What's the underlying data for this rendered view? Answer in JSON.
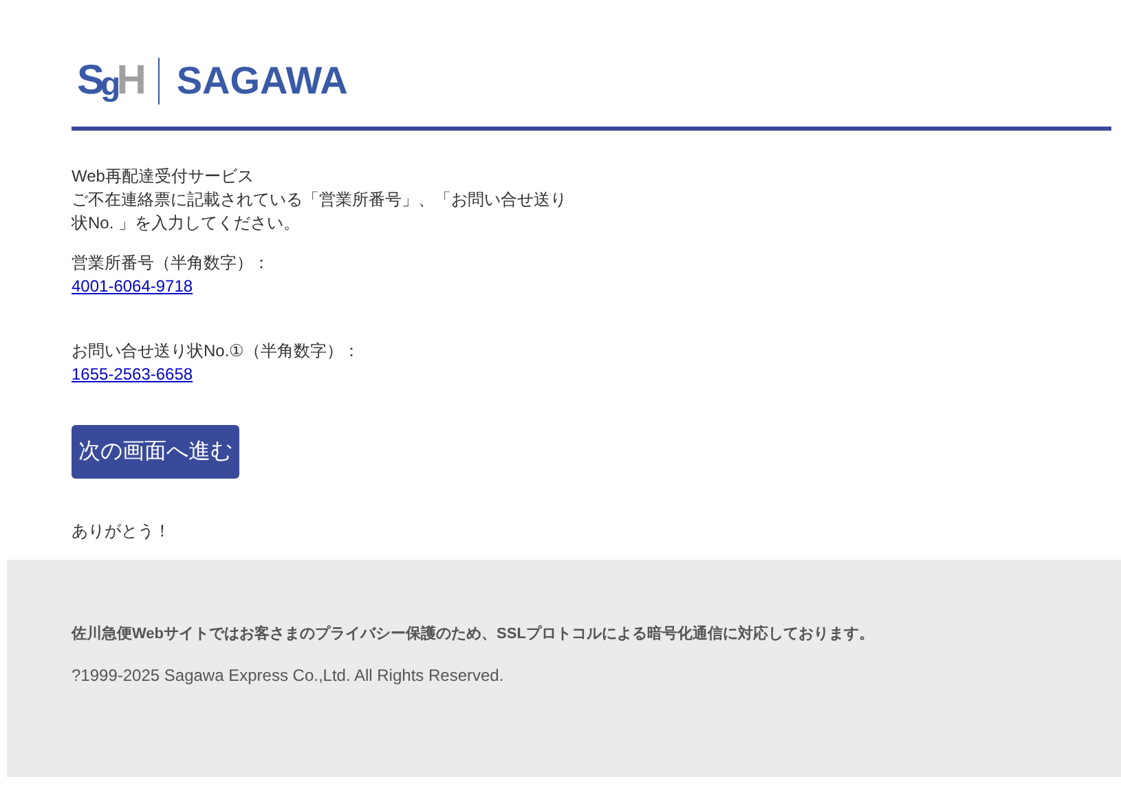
{
  "logo": {
    "mark": [
      "S",
      "g",
      "H"
    ],
    "wordmark": "SAGAWA"
  },
  "intro": {
    "title": "Web再配達受付サービス",
    "text": "ご不在連絡票に記載されている「営業所番号」、「お問い合せ送り状No. 」を入力してください。"
  },
  "fields": [
    {
      "label": "営業所番号（半角数字）：",
      "value": "4001-6064-9718"
    },
    {
      "label": "お問い合せ送り状No.①（半角数字）：",
      "value": "1655-2563-6658"
    }
  ],
  "button": "次の画面へ進む",
  "thanks": "ありがとう！",
  "footer": {
    "notice": "佐川急便Webサイトではお客さまのプライバシー保護のため、SSLプロトコルによる暗号化通信に対応しております。",
    "copyright": "?1999-2025 Sagawa Express Co.,Ltd. All Rights Reserved."
  }
}
